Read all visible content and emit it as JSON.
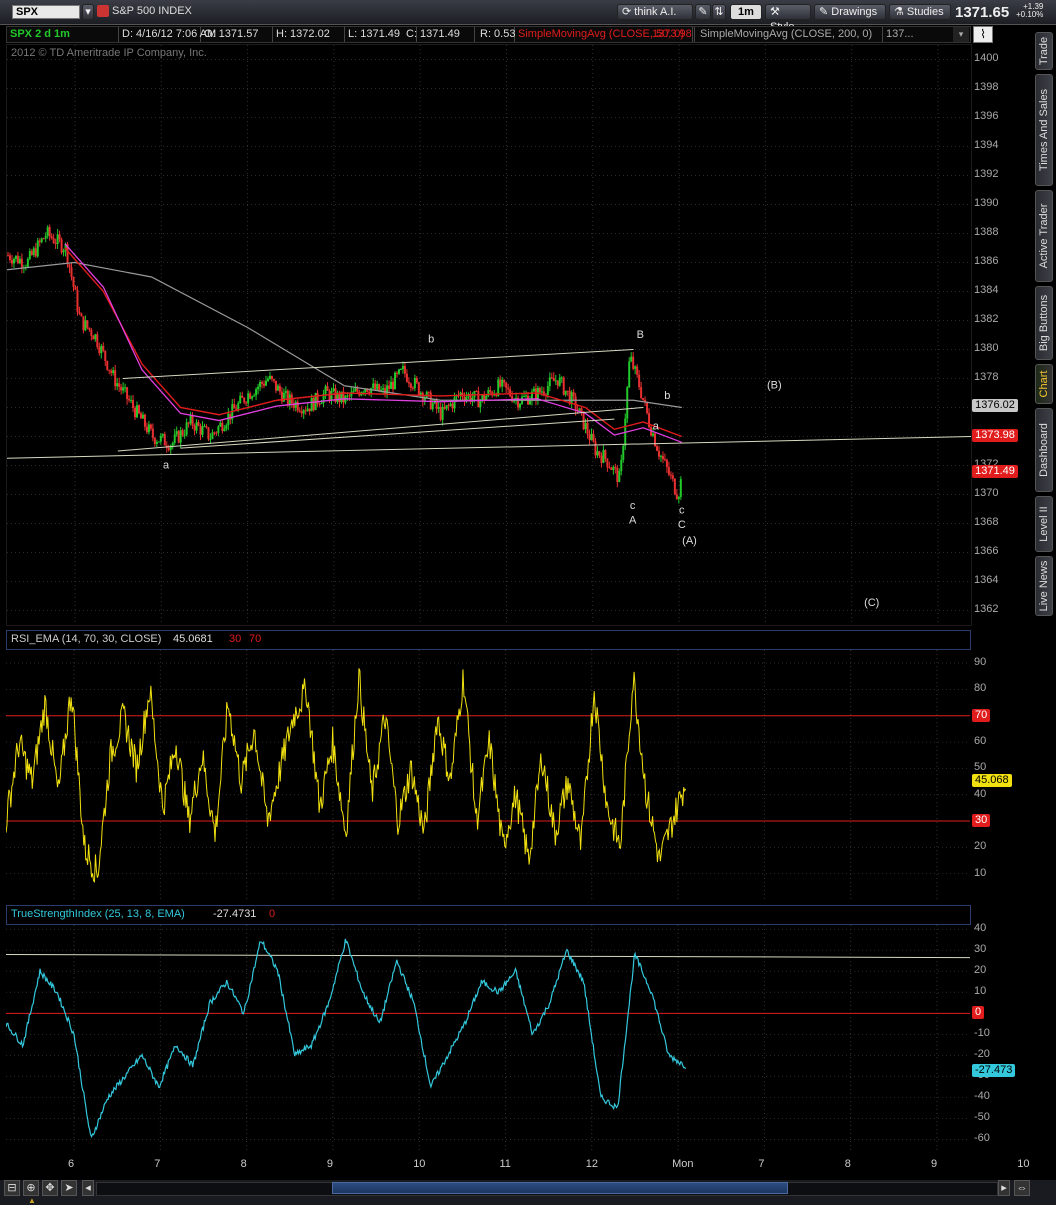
{
  "toolbar": {
    "symbol": "SPX",
    "description": "S&P 500 INDEX",
    "think_label": "think A.I.",
    "timeframe": "1m",
    "style_label": "Style",
    "drawings_label": "Drawings",
    "studies_label": "Studies",
    "last_price": "1371.65",
    "change": "+1.39",
    "change_pct": "+0.10%"
  },
  "infobar": {
    "symbol_period": "SPX 2 d 1m",
    "datetime": "D: 4/16/12 7:06 AM",
    "open": "O: 1371.57",
    "high": "H: 1372.02",
    "low": "L: 1371.49",
    "close": "C: 1371.49",
    "range": "R: 0.53",
    "sma50": "SimpleMovingAvg (CLOSE, 50, 0)",
    "sma50_val": "1373.98",
    "sma200": "SimpleMovingAvg (CLOSE, 200, 0)",
    "sma200_val": "137..."
  },
  "copyright": "2012 © TD Ameritrade IP Company, Inc.",
  "colors": {
    "up": "#22c92a",
    "down": "#e83030",
    "sma50": "#e01c1c",
    "sma200": "#9a9a9a",
    "ema_pink": "#e040e0",
    "rsi": "#f0e010",
    "tsi": "#33c8dc",
    "level_line": "#e01c1c"
  },
  "right_tabs": [
    "Trade",
    "Times And Sales",
    "Active Trader",
    "Big Buttons",
    "Chart",
    "Dashboard",
    "Level II",
    "Live News"
  ],
  "main_pane": {
    "y_ticks": [
      "1400",
      "1398",
      "1396",
      "1394",
      "1392",
      "1390",
      "1388",
      "1386",
      "1384",
      "1382",
      "1380",
      "1378",
      "1376",
      "1374",
      "1372",
      "1370",
      "1368",
      "1366",
      "1364",
      "1362"
    ],
    "badges": [
      {
        "label": "1376.02",
        "value": 1376.02,
        "color": "#c8c8c8",
        "text": "#000"
      },
      {
        "label": "1373.98",
        "value": 1373.98,
        "color": "#e01c1c",
        "text": "#fff"
      },
      {
        "label": "1371.49",
        "value": 1371.49,
        "color": "#e01c1c",
        "text": "#fff"
      }
    ],
    "wave_labels": [
      {
        "t": "a",
        "xi": 0.165,
        "v": 1371.8
      },
      {
        "t": "b",
        "xi": 0.44,
        "v": 1380.5
      },
      {
        "t": "B",
        "xi": 0.657,
        "v": 1380.8
      },
      {
        "t": "b",
        "xi": 0.685,
        "v": 1376.6
      },
      {
        "t": "a",
        "xi": 0.673,
        "v": 1374.5
      },
      {
        "t": "c",
        "xi": 0.649,
        "v": 1369.0
      },
      {
        "t": "A",
        "xi": 0.649,
        "v": 1368.0
      },
      {
        "t": "c",
        "xi": 0.7,
        "v": 1368.7
      },
      {
        "t": "C",
        "xi": 0.7,
        "v": 1367.7
      },
      {
        "t": "(A)",
        "xi": 0.708,
        "v": 1366.6
      },
      {
        "t": "(B)",
        "xi": 0.796,
        "v": 1377.3
      },
      {
        "t": "(C)",
        "xi": 0.897,
        "v": 1362.3
      }
    ]
  },
  "rsi_pane": {
    "title": "RSI_EMA (14, 70, 30, CLOSE)",
    "value": "45.0681",
    "ob": "30",
    "os": "70",
    "y_ticks": [
      "90",
      "80",
      "70",
      "60",
      "50",
      "40",
      "30",
      "20",
      "10"
    ],
    "badge": "45.068",
    "level_badges": [
      "70",
      "30"
    ]
  },
  "tsi_pane": {
    "title": "TrueStrengthIndex (25, 13, 8, EMA)",
    "value": "-27.4731",
    "zero": "0",
    "y_ticks": [
      "40",
      "30",
      "20",
      "10",
      "0",
      "-10",
      "-20",
      "-30",
      "-40",
      "-50",
      "-60"
    ],
    "badge": "-27.473",
    "zero_badge": "0"
  },
  "x_axis": [
    "6",
    "7",
    "8",
    "9",
    "10",
    "11",
    "12",
    "Mon",
    "7",
    "8",
    "9",
    "10"
  ],
  "chart_data": {
    "type": "line",
    "title": "SPX 2 d 1m",
    "series": [
      {
        "name": "SPX",
        "x_index": [
          0,
          0.02,
          0.04,
          0.06,
          0.075,
          0.09,
          0.11,
          0.13,
          0.15,
          0.17,
          0.19,
          0.21,
          0.23,
          0.25,
          0.27,
          0.29,
          0.31,
          0.33,
          0.35,
          0.37,
          0.39,
          0.41,
          0.43,
          0.45,
          0.47,
          0.49,
          0.51,
          0.53,
          0.55,
          0.57,
          0.59,
          0.61,
          0.62,
          0.635,
          0.645,
          0.655,
          0.665,
          0.675,
          0.685,
          0.695,
          0.7
        ],
        "values": [
          1386.5,
          1386.0,
          1388.0,
          1387.0,
          1382.0,
          1381.0,
          1378.0,
          1376.0,
          1374.0,
          1373.5,
          1375.0,
          1374.0,
          1375.5,
          1377.0,
          1378.0,
          1376.5,
          1376.0,
          1377.0,
          1376.5,
          1377.5,
          1377.0,
          1378.5,
          1377.0,
          1375.5,
          1377.0,
          1376.5,
          1377.5,
          1376.5,
          1377.0,
          1378.0,
          1376.0,
          1373.0,
          1372.5,
          1371.0,
          1379.5,
          1377.5,
          1375.0,
          1373.0,
          1371.5,
          1370.0,
          1371.5
        ]
      },
      {
        "name": "SimpleMovingAvg (CLOSE, 50, 0)",
        "x_index": [
          0.06,
          0.1,
          0.14,
          0.18,
          0.22,
          0.28,
          0.35,
          0.45,
          0.55,
          0.6,
          0.63,
          0.66,
          0.7
        ],
        "values": [
          1387.0,
          1384.0,
          1379.0,
          1376.0,
          1375.5,
          1376.5,
          1377.0,
          1376.8,
          1377.0,
          1376.0,
          1374.5,
          1375.0,
          1374.0
        ]
      },
      {
        "name": "SimpleMovingAvg (CLOSE, 200, 0)",
        "x_index": [
          0,
          0.07,
          0.15,
          0.25,
          0.35,
          0.45,
          0.55,
          0.65,
          0.7
        ],
        "values": [
          1385.5,
          1386.0,
          1385.0,
          1381.5,
          1377.5,
          1376.5,
          1376.5,
          1376.5,
          1376.0
        ]
      }
    ],
    "rsi": {
      "name": "RSI_EMA (14, 70, 30, CLOSE)",
      "values": [
        30,
        60,
        45,
        75,
        40,
        80,
        20,
        10,
        55,
        70,
        50,
        80,
        35,
        60,
        30,
        55,
        25,
        75,
        45,
        65,
        30,
        50,
        70,
        80,
        35,
        60,
        25,
        85,
        40,
        70,
        30,
        50,
        25,
        70,
        45,
        85,
        30,
        60,
        20,
        40,
        15,
        55,
        25,
        45,
        20,
        80,
        35,
        20,
        85,
        40,
        15,
        30,
        45
      ]
    },
    "tsi": {
      "name": "TrueStrengthIndex (25, 13, 8, EMA)",
      "values": [
        -5,
        -15,
        20,
        10,
        -10,
        -60,
        -40,
        -30,
        -20,
        -35,
        -15,
        -25,
        5,
        15,
        0,
        35,
        20,
        -20,
        -15,
        5,
        35,
        10,
        -5,
        25,
        5,
        -35,
        -20,
        -5,
        15,
        10,
        20,
        -10,
        5,
        30,
        15,
        -40,
        -45,
        28,
        10,
        -20,
        -25
      ]
    },
    "ylim_main": [
      1361,
      1401
    ],
    "ylim_rsi": [
      0,
      95
    ],
    "ylim_tsi": [
      -65,
      42
    ]
  }
}
